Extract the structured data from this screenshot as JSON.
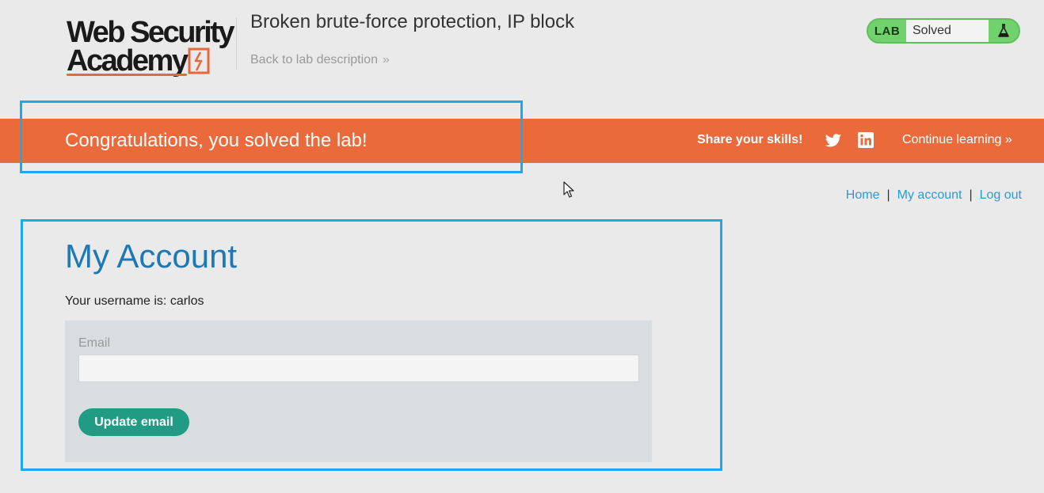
{
  "header": {
    "logo_line1": "Web Security",
    "logo_line2": "Academy",
    "lab_title": "Broken brute-force protection, IP block",
    "back_link": "Back to lab description",
    "back_chevron": "»",
    "lab_status": {
      "tag": "LAB",
      "state": "Solved",
      "tag_color": "#70d16d",
      "icon": "flask-icon"
    }
  },
  "banner": {
    "message": "Congratulations, you solved the lab!",
    "share_label": "Share your skills!",
    "icons": [
      "twitter-icon",
      "linkedin-icon"
    ],
    "continue_label": "Continue learning",
    "continue_chevron": "»",
    "color": "#ea6a3c"
  },
  "nav": {
    "items": [
      {
        "label": "Home"
      },
      {
        "label": "My account"
      },
      {
        "label": "Log out"
      }
    ],
    "separator": "|"
  },
  "account": {
    "heading": "My Account",
    "username_line": "Your username is: carlos",
    "email_label": "Email",
    "email_value": "",
    "update_button": "Update email"
  },
  "colors": {
    "accent": "#1e78b4",
    "link": "#2b9ad8",
    "button": "#229b84",
    "highlight": "#1aa9f0"
  }
}
